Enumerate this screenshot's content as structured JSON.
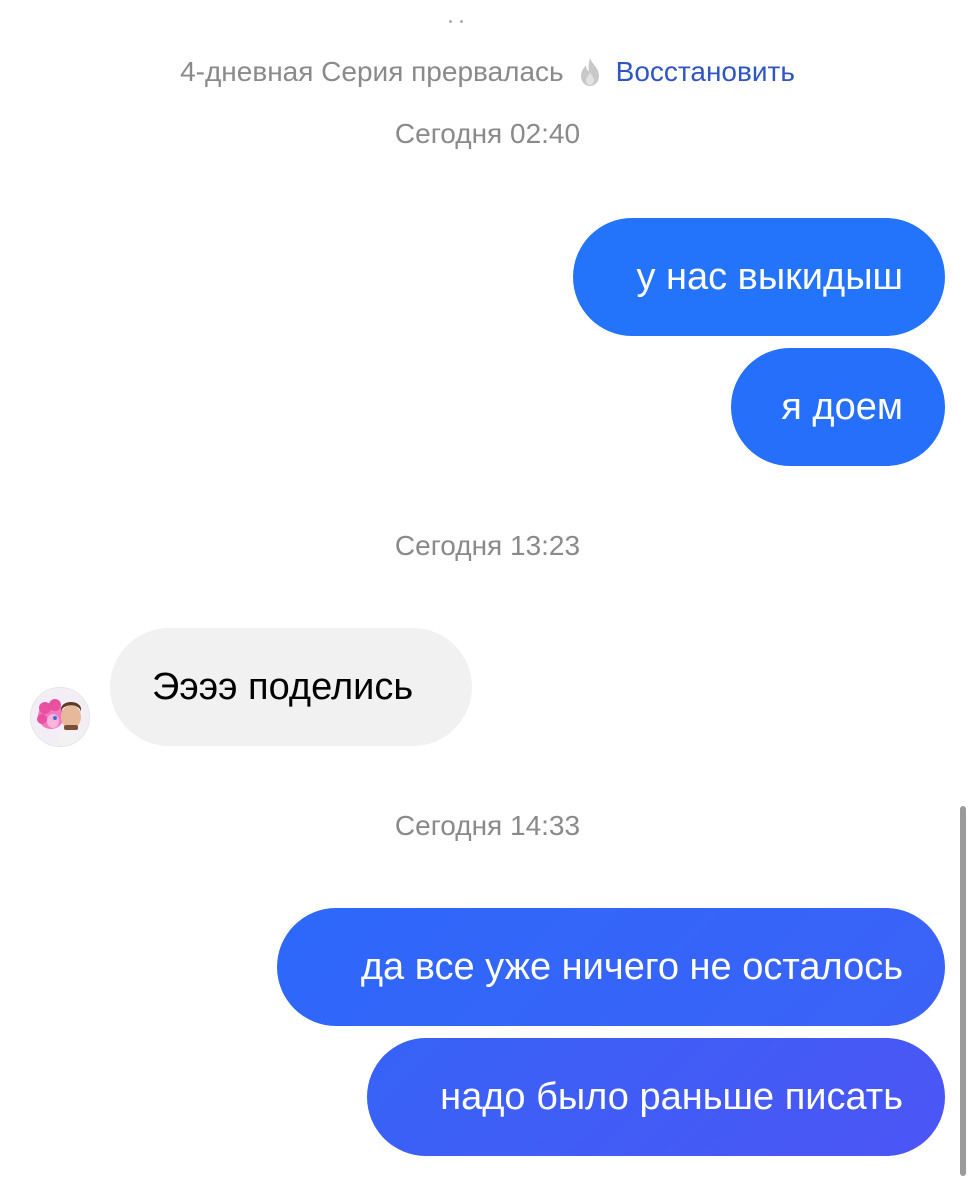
{
  "streak": {
    "text": "4-дневная Серия прервалась",
    "icon": "fire-icon",
    "restore_label": "Восстановить"
  },
  "timestamps": [
    "Сегодня 02:40",
    "Сегодня 13:23",
    "Сегодня 14:33"
  ],
  "messages": [
    {
      "direction": "outgoing",
      "text": "у нас выкидыш"
    },
    {
      "direction": "outgoing",
      "text": "я доем"
    },
    {
      "direction": "incoming",
      "text": "Ээээ поделись",
      "avatar": "avatar"
    },
    {
      "direction": "outgoing",
      "text": "да все уже ничего не осталось"
    },
    {
      "direction": "outgoing",
      "text": "надо было раньше писать"
    }
  ],
  "colors": {
    "outgoing_top": "#2374fb",
    "outgoing_bottom": "#4c55f5",
    "incoming_bg": "#f1f1f2",
    "link": "#2f56c4",
    "meta_text": "#8a8a8a"
  }
}
